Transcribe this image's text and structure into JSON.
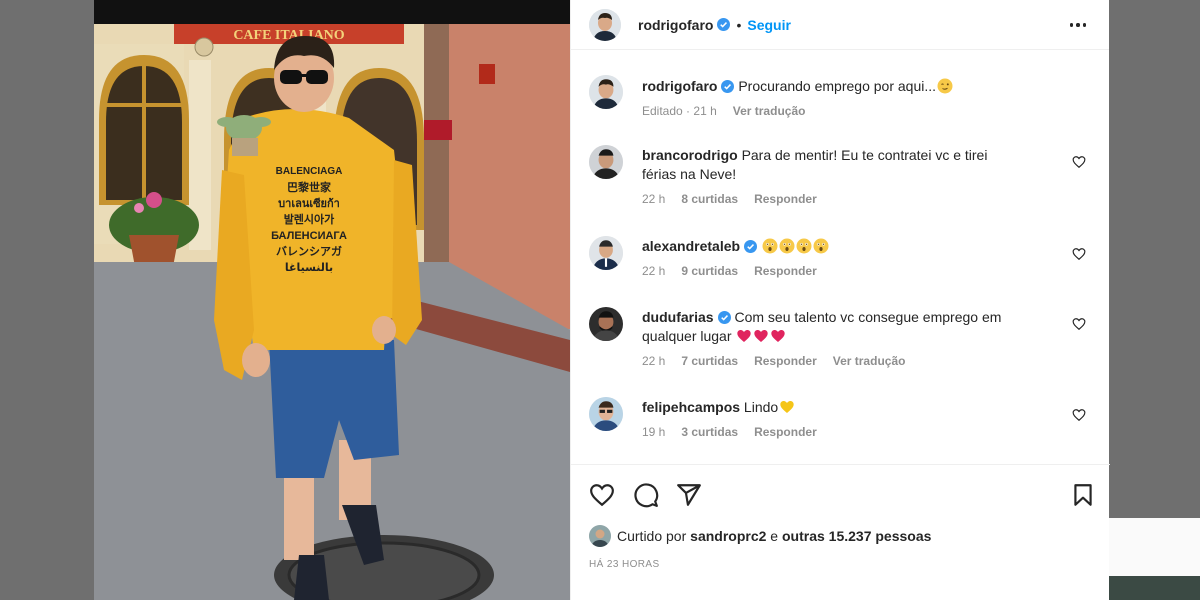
{
  "post": {
    "username": "rodrigofaro",
    "follow_label": "Seguir",
    "separator": "•",
    "sign_text": "CAFE ITALIANO",
    "caption": "Procurando emprego por aqui...",
    "caption_emoji": "winking-face",
    "caption_meta_edited": "Editado",
    "caption_meta_dot": "·",
    "caption_meta_time": "21 h",
    "translate_label": "Ver tradução",
    "hoodie_brand": "BALENCIAGA",
    "hoodie_lines": [
      "巴黎世家",
      "บาเลนเซียก้า",
      "발렌시아가",
      "БАЛЕНСИАГА",
      "バレンシアガ",
      "بالنسياغا"
    ]
  },
  "comments": [
    {
      "username": "brancorodrigo",
      "verified": false,
      "text_line1": "Para de mentir! Eu te contratei vc e tirei",
      "text_line2": "férias na Neve!",
      "time": "22 h",
      "likes": "8 curtidas",
      "reply": "Responder",
      "translate": ""
    },
    {
      "username": "alexandretaleb",
      "verified": true,
      "text_line1": "",
      "emojis": "astonished-x4",
      "time": "22 h",
      "likes": "9 curtidas",
      "reply": "Responder",
      "translate": ""
    },
    {
      "username": "dudufarias",
      "verified": true,
      "text_line1": "Com seu talento vc consegue emprego em",
      "text_line2": "qualquer lugar",
      "emojis": "red-heart-x3",
      "time": "22 h",
      "likes": "7 curtidas",
      "reply": "Responder",
      "translate": "Ver tradução"
    },
    {
      "username": "felipehcampos",
      "verified": false,
      "text_line1": "Lindo",
      "emojis": "yellow-heart",
      "time": "19 h",
      "likes": "3 curtidas",
      "reply": "Responder",
      "translate": ""
    }
  ],
  "likes_bar": {
    "prefix": "Curtido por",
    "user": "sandroprc2",
    "conj": "e",
    "others": "outras 15.237 pessoas",
    "time": "HÁ 23 HORAS"
  },
  "icons": {
    "like": "heart-outline-icon",
    "comment": "comment-bubble-icon",
    "share": "paper-plane-icon",
    "save": "bookmark-icon",
    "more": "more-dots-icon",
    "verified": "verified-badge-icon"
  },
  "colors": {
    "accent": "#0095f6",
    "verified": "#3897f0",
    "muted": "#8e8e8e",
    "heart_red": "#e0245e",
    "hoodie": "#f0b429"
  }
}
